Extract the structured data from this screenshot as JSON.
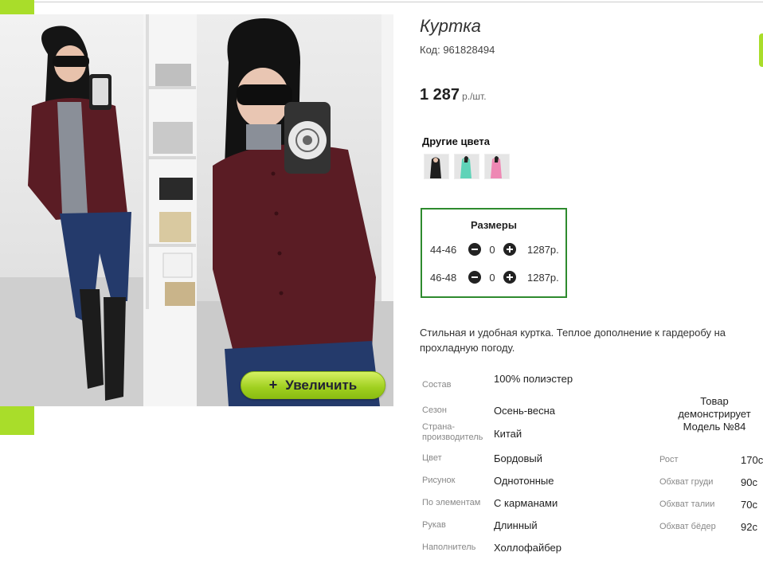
{
  "product": {
    "title": "Куртка",
    "code": "Код: 961828494",
    "price": "1 287",
    "price_unit": "р./шт."
  },
  "zoom_button": {
    "icon": "plus-icon",
    "label": "Увеличить"
  },
  "other_colors": {
    "title": "Другие цвета",
    "swatch_count": 3
  },
  "sizes": {
    "title": "Размеры",
    "rows": [
      {
        "size": "44-46",
        "qty": "0",
        "price": "1287р."
      },
      {
        "size": "46-48",
        "qty": "0",
        "price": "1287р."
      }
    ]
  },
  "description": "Стильная и удобная куртка. Теплое дополнение к гардеробу на прохладную погоду.",
  "specs": [
    {
      "label": "Состав",
      "value": "100% полиэстер"
    },
    {
      "label": "Сезон",
      "value": "Осень-весна"
    },
    {
      "label": "Страна-производитель",
      "value": "Китай"
    },
    {
      "label": "Цвет",
      "value": "Бордовый"
    },
    {
      "label": "Рисунок",
      "value": "Однотонные"
    },
    {
      "label": "По элементам",
      "value": "С карманами"
    },
    {
      "label": "Рукав",
      "value": "Длинный"
    },
    {
      "label": "Наполнитель",
      "value": "Холлофайбер"
    }
  ],
  "model": {
    "title": "Товар демонстрирует Модель №84",
    "measurements": [
      {
        "label": "Рост",
        "value": "170с"
      },
      {
        "label": "Обхват груди",
        "value": "90с"
      },
      {
        "label": "Обхват талии",
        "value": "70с"
      },
      {
        "label": "Обхват бёдер",
        "value": "92с"
      }
    ]
  },
  "colors": {
    "accent_green": "#a9dd2a",
    "size_box_border": "#2e8b2e",
    "jacket": "#5a1c24"
  }
}
